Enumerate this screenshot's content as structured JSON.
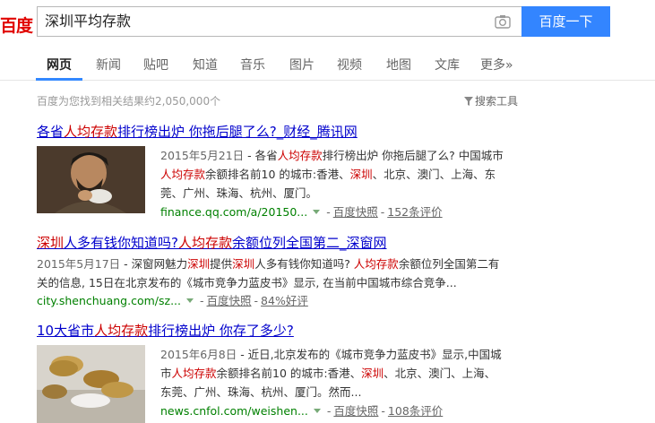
{
  "header": {
    "logo": "百度",
    "query": "深圳平均存款",
    "search_button": "百度一下"
  },
  "nav": {
    "tabs": [
      "网页",
      "新闻",
      "贴吧",
      "知道",
      "音乐",
      "图片",
      "视频",
      "地图",
      "文库",
      "更多»"
    ]
  },
  "result_count": "百度为您找到相关结果约2,050,000个",
  "search_tools": "搜索工具",
  "results": [
    {
      "title_parts": [
        "各省",
        "人均存款",
        "排行榜出炉 你拖后腿了么?_财经_腾讯网"
      ],
      "date": "2015年5月21日",
      "snippet_l1": [
        " - 各省",
        "人均存款",
        "排行榜出炉 你拖后腿了么? 中国城市"
      ],
      "snippet_l2": [
        "",
        "人均存款",
        "余额排名前10 的城市:香港、",
        "深圳",
        "、北京、澳门、上海、东"
      ],
      "snippet_l3": "莞、广州、珠海、杭州、厦门。",
      "url": "finance.qq.com/a/20150...",
      "kuaizhao": "百度快照",
      "rating": "152条评价"
    },
    {
      "title_parts": [
        "深圳",
        "人多有钱你知道吗?",
        "人均存款",
        "余额位列全国第二_深窗网"
      ],
      "date": "2015年5月17日",
      "snippet_l1": [
        " - 深窗网魅力",
        "深圳",
        "提供",
        "深圳",
        "人多有钱你知道吗? ",
        "人均存款",
        "余额位列全国第二有"
      ],
      "snippet_l2": "关的信息, 15日在北京发布的《城市竞争力蓝皮书》显示, 在当前中国城市综合竞争...",
      "url": "city.shenchuang.com/sz...",
      "kuaizhao": "百度快照",
      "rating": "84%好评"
    },
    {
      "title_parts": [
        "10大省市",
        "人均存款",
        "排行榜出炉 你存了多少?"
      ],
      "date": "2015年6月8日",
      "snippet_l1": " - 近日,北京发布的《城市竞争力蓝皮书》显示,中国城",
      "snippet_l2": [
        "市",
        "人均存款",
        "余额排名前10 的城市:香港、",
        "深圳",
        "、北京、澳门、上海、"
      ],
      "snippet_l3": "东莞、广州、珠海、杭州、厦门。然而...",
      "url": "news.cnfol.com/weishen...",
      "kuaizhao": "百度快照",
      "rating": "108条评价"
    }
  ]
}
